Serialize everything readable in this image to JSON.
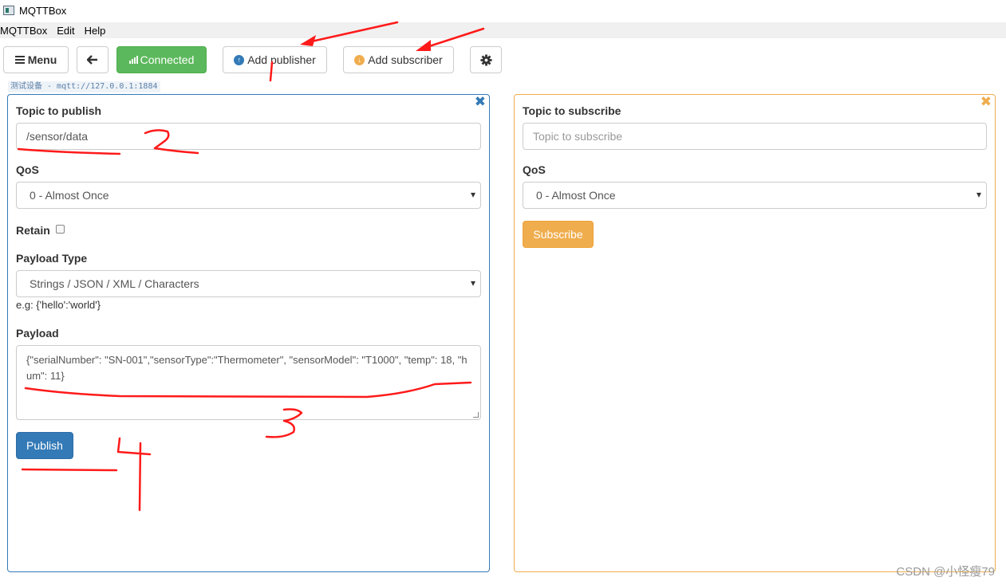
{
  "window": {
    "title": "MQTTBox"
  },
  "menubar": {
    "items": [
      "MQTTBox",
      "Edit",
      "Help"
    ]
  },
  "toolbar": {
    "menu_label": "Menu",
    "connected_label": "Connected",
    "add_publisher_label": "Add publisher",
    "add_subscriber_label": "Add subscriber"
  },
  "connection": {
    "label": "测试设备 - mqtt://127.0.0.1:1884"
  },
  "publisher": {
    "topic_label": "Topic to publish",
    "topic_value": "/sensor/data",
    "qos_label": "QoS",
    "qos_value": "0 - Almost Once",
    "retain_label": "Retain",
    "payload_type_label": "Payload Type",
    "payload_type_value": "Strings / JSON / XML / Characters",
    "payload_hint": "e.g: {'hello':'world'}",
    "payload_label": "Payload",
    "payload_value": "{\"serialNumber\": \"SN-001\",\"sensorType\":\"Thermometer\", \"sensorModel\": \"T1000\", \"temp\": 18, \"hum\": 11}",
    "publish_label": "Publish"
  },
  "subscriber": {
    "topic_label": "Topic to subscribe",
    "topic_placeholder": "Topic to subscribe",
    "qos_label": "QoS",
    "qos_value": "0 - Almost Once",
    "subscribe_label": "Subscribe"
  },
  "annotations": {
    "numbers": [
      "1",
      "2",
      "3",
      "4"
    ],
    "color": "#ff1a1a"
  },
  "watermark": "CSDN @小怪瘦79",
  "colors": {
    "primary": "#337ab7",
    "success": "#5cb85c",
    "warning": "#f0ad4e"
  },
  "icons": [
    "app-icon",
    "hamburger-icon",
    "arrow-left-icon",
    "signal-icon",
    "arrow-circle-up-icon",
    "arrow-circle-down-icon",
    "gear-icon",
    "close-icon"
  ]
}
